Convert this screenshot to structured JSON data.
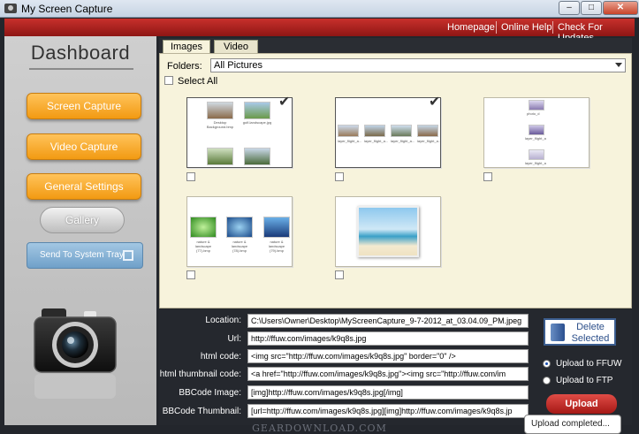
{
  "window": {
    "title": "My Screen Capture",
    "controls": {
      "minimize": "–",
      "maximize": "□",
      "close": "✕"
    }
  },
  "topnav": [
    "Homepage",
    "Online Help",
    "Check For Updates"
  ],
  "sidebar": {
    "title": "Dashboard",
    "buttons": {
      "screen_capture": "Screen Capture",
      "video_capture": "Video Capture",
      "general_settings": "General Settings",
      "gallery": "Gallery",
      "send_to_tray": "Send To System Tray"
    }
  },
  "tabs": [
    "Images",
    "Video"
  ],
  "gallery": {
    "folders_label": "Folders:",
    "folders_value": "All Pictures",
    "select_all": "Select All",
    "albums": [
      {
        "captions": [
          "Desktop Background.bmp",
          "golf-landscape.jpg"
        ],
        "checked": true
      },
      {
        "captions": [
          "layer_flight_a...",
          "layer_flight_a...",
          "layer_flight_a...",
          "layer_flight_a..."
        ],
        "checked": true
      },
      {
        "captions": [
          "photo_d",
          "layer_flight_a",
          "layer_flight_a"
        ],
        "checked": false
      },
      {
        "captions": [
          "nature & landscape (77).bmp",
          "nature & landscape (78).bmp",
          "nature & landscape (79).bmp"
        ],
        "checked": false
      },
      {
        "captions": [],
        "checked": false
      }
    ]
  },
  "details": {
    "location_label": "Location:",
    "location_value": "C:\\Users\\Owner\\Desktop\\MyScreenCapture_9-7-2012_at_03.04.09_PM.jpeg",
    "url_label": "Url:",
    "url_value": "http://ffuw.com/images/k9q8s.jpg",
    "html_label": "html code:",
    "html_value": "<img src=\"http://ffuw.com/images/k9q8s.jpg\" border=\"0\" />",
    "html_thumb_label": "html thumbnail code:",
    "html_thumb_value": "<a href=\"http://ffuw.com/images/k9q8s.jpg\"><img src=\"http://ffuw.com/im",
    "bbcode_label": "BBCode Image:",
    "bbcode_value": "[img]http://ffuw.com/images/k9q8s.jpg[/img]",
    "bbcode_thumb_label": "BBCode Thumbnail:",
    "bbcode_thumb_value": "[url=http://ffuw.com/images/k9q8s.jpg][img]http://ffuw.com/images/k9q8s.jp"
  },
  "actions": {
    "delete_line1": "Delete",
    "delete_line2": "Selected",
    "upload_ffuw": "Upload to FFUW",
    "upload_ftp": "Upload to FTP",
    "upload": "Upload",
    "upload_ffuw_selected": true
  },
  "status": {
    "toast": "Upload completed..."
  },
  "watermark": "GEARDOWNLOAD.COM"
}
